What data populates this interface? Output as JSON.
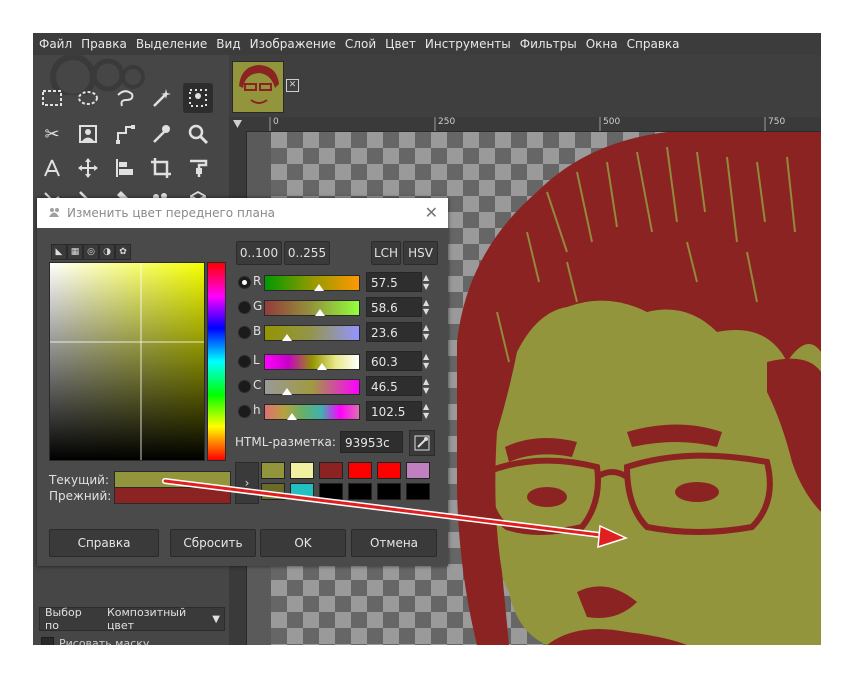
{
  "menu": [
    "Файл",
    "Правка",
    "Выделение",
    "Вид",
    "Изображение",
    "Слой",
    "Цвет",
    "Инструменты",
    "Фильтры",
    "Окна",
    "Справка"
  ],
  "tools": [
    "rect-select",
    "ellipse-select",
    "free-select",
    "fuzzy-select",
    "foreground-select",
    "crop",
    "transform",
    "align",
    "color-picker",
    "zoom",
    "paths",
    "move",
    "alignment",
    "crop-2",
    "text",
    "warp",
    "smudge",
    "path-2",
    "bucket",
    "3d"
  ],
  "ruler": {
    "marks": [
      "0",
      "250",
      "500",
      "750"
    ]
  },
  "tool_options": {
    "select_by_label": "Выбор по",
    "select_by_value": "Композитный цвет",
    "draw_mask_label": "Рисовать маску"
  },
  "dialog": {
    "title": "Изменить цвет переднего плана",
    "range_buttons": [
      "0..100",
      "0..255"
    ],
    "model_buttons": [
      "LCH",
      "HSV"
    ],
    "channels": [
      {
        "letter": "R",
        "value": "57.5",
        "selected": true,
        "gradient": "linear-gradient(to right,#009900,#939900,#ff9900)"
      },
      {
        "letter": "G",
        "value": "58.6",
        "selected": false,
        "gradient": "linear-gradient(to right,#933c3c,#93953c,#93ff3c)"
      },
      {
        "letter": "B",
        "value": "23.6",
        "selected": false,
        "gradient": "linear-gradient(to right,#939500,#93954f,#9395ff)"
      },
      {
        "letter": "L",
        "value": "60.3",
        "selected": false,
        "gradient": "linear-gradient(to right,#ff00ff,#c800c8,#939500,#e8e888,#ffffff)"
      },
      {
        "letter": "C",
        "value": "46.5",
        "selected": false,
        "gradient": "linear-gradient(to right,#9a9a9a,#a09a40,#ff00ff)"
      },
      {
        "letter": "h",
        "value": "102.5",
        "selected": false,
        "gradient": "linear-gradient(to right,#e07070,#b8a040,#66b066,#40b0b0,#ff00ff,#e070b0)"
      }
    ],
    "html_label": "HTML-разметка:",
    "html_value": "93953c",
    "current_label": "Текущий:",
    "old_label": "Прежний:",
    "current_color": "#93953c",
    "old_color": "#8b2323",
    "history_colors": [
      "#93953c",
      "#f0f0a0",
      "#8b2323",
      "#ff0000",
      "#ff0000",
      "#c080c0",
      "#6a6a2a",
      "#22c0c0",
      "#000000",
      "#000000",
      "#000000",
      "#000000"
    ],
    "buttons": {
      "help": "Справка",
      "reset": "Сбросить",
      "ok": "OK",
      "cancel": "Отмена"
    }
  },
  "colors": {
    "maroon": "#8b2323",
    "olive": "#93953c",
    "arrow": "#e02020"
  }
}
